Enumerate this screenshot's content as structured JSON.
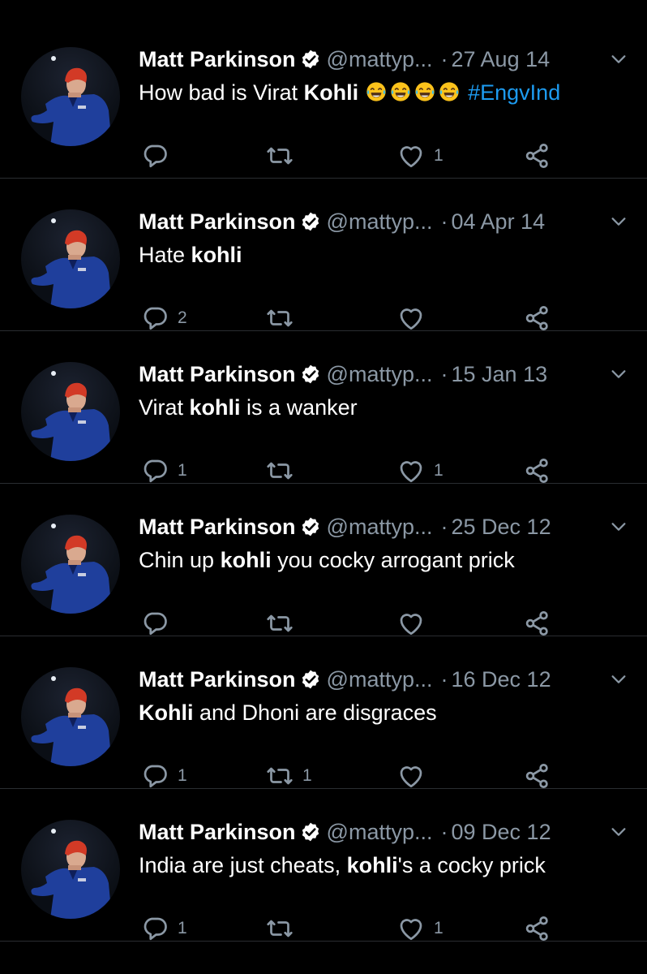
{
  "tweets": [
    {
      "name": "Matt Parkinson",
      "handle": "@mattyp...",
      "date": "27 Aug 14",
      "text": [
        {
          "t": "How bad is Virat ",
          "s": "normal"
        },
        {
          "t": "Kohli",
          "s": "bold"
        },
        {
          "t": " ",
          "s": "normal"
        },
        {
          "t": "",
          "s": "emoji4"
        },
        {
          "t": " #EngvInd",
          "s": "hashtag"
        }
      ],
      "reply_count": "",
      "retweet_count": "",
      "like_count": "1"
    },
    {
      "name": "Matt Parkinson",
      "handle": "@mattyp...",
      "date": "04 Apr 14",
      "text": [
        {
          "t": "Hate ",
          "s": "normal"
        },
        {
          "t": "kohli",
          "s": "bold"
        }
      ],
      "reply_count": "2",
      "retweet_count": "",
      "like_count": ""
    },
    {
      "name": "Matt Parkinson",
      "handle": "@mattyp...",
      "date": "15 Jan 13",
      "text": [
        {
          "t": "Virat ",
          "s": "normal"
        },
        {
          "t": "kohli",
          "s": "bold"
        },
        {
          "t": " is a wanker",
          "s": "normal"
        }
      ],
      "reply_count": "1",
      "retweet_count": "",
      "like_count": "1"
    },
    {
      "name": "Matt Parkinson",
      "handle": "@mattyp...",
      "date": "25 Dec 12",
      "text": [
        {
          "t": "Chin up ",
          "s": "normal"
        },
        {
          "t": "kohli",
          "s": "bold"
        },
        {
          "t": " you cocky arrogant prick",
          "s": "normal"
        }
      ],
      "reply_count": "",
      "retweet_count": "",
      "like_count": ""
    },
    {
      "name": "Matt Parkinson",
      "handle": "@mattyp...",
      "date": "16 Dec 12",
      "text": [
        {
          "t": "Kohli",
          "s": "bold"
        },
        {
          "t": " and Dhoni are disgraces",
          "s": "normal"
        }
      ],
      "reply_count": "1",
      "retweet_count": "1",
      "like_count": ""
    },
    {
      "name": "Matt Parkinson",
      "handle": "@mattyp...",
      "date": "09 Dec 12",
      "text": [
        {
          "t": "India are just cheats, ",
          "s": "normal"
        },
        {
          "t": "kohli",
          "s": "bold"
        },
        {
          "t": "'s a cocky prick",
          "s": "normal"
        }
      ],
      "reply_count": "1",
      "retweet_count": "",
      "like_count": "1"
    }
  ],
  "icons": {
    "verified": "verified-badge-icon",
    "caret": "chevron-down-icon",
    "reply": "reply-icon",
    "retweet": "retweet-icon",
    "like": "heart-icon",
    "share": "share-icon",
    "emoji": "face-with-tears-of-joy-icon"
  },
  "colors": {
    "background": "#000000",
    "text": "#ffffff",
    "muted": "#8b98a5",
    "hashtag": "#1d9bf0",
    "divider": "#2a2d31"
  }
}
